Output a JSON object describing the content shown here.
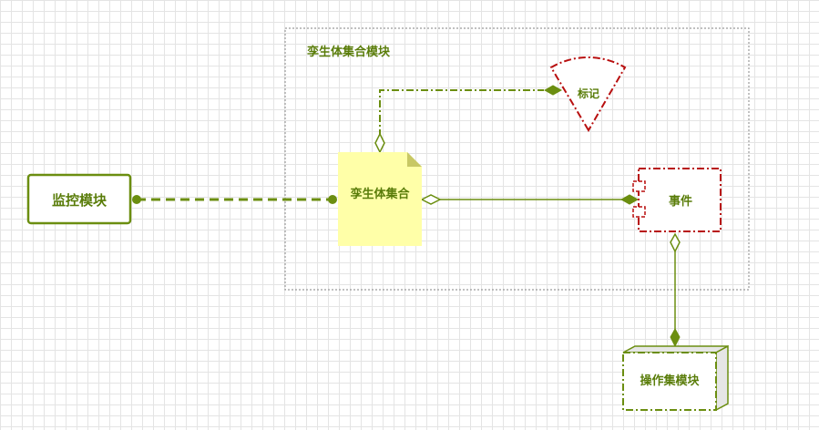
{
  "colors": {
    "green": "#6b8e10",
    "dark_green": "#5a7d0a",
    "red": "#b80f0f",
    "note_fill": "#ffffa8",
    "note_fold": "#c8c864",
    "container_border": "#9a9a9a",
    "node_side": "#e6e6e6"
  },
  "diagram": {
    "container_title": "孪生体集合模块",
    "monitor_module": "监控模块",
    "twin_collection": "孪生体集合",
    "marker": "标记",
    "event": "事件",
    "operation_module": "操作集模块"
  }
}
